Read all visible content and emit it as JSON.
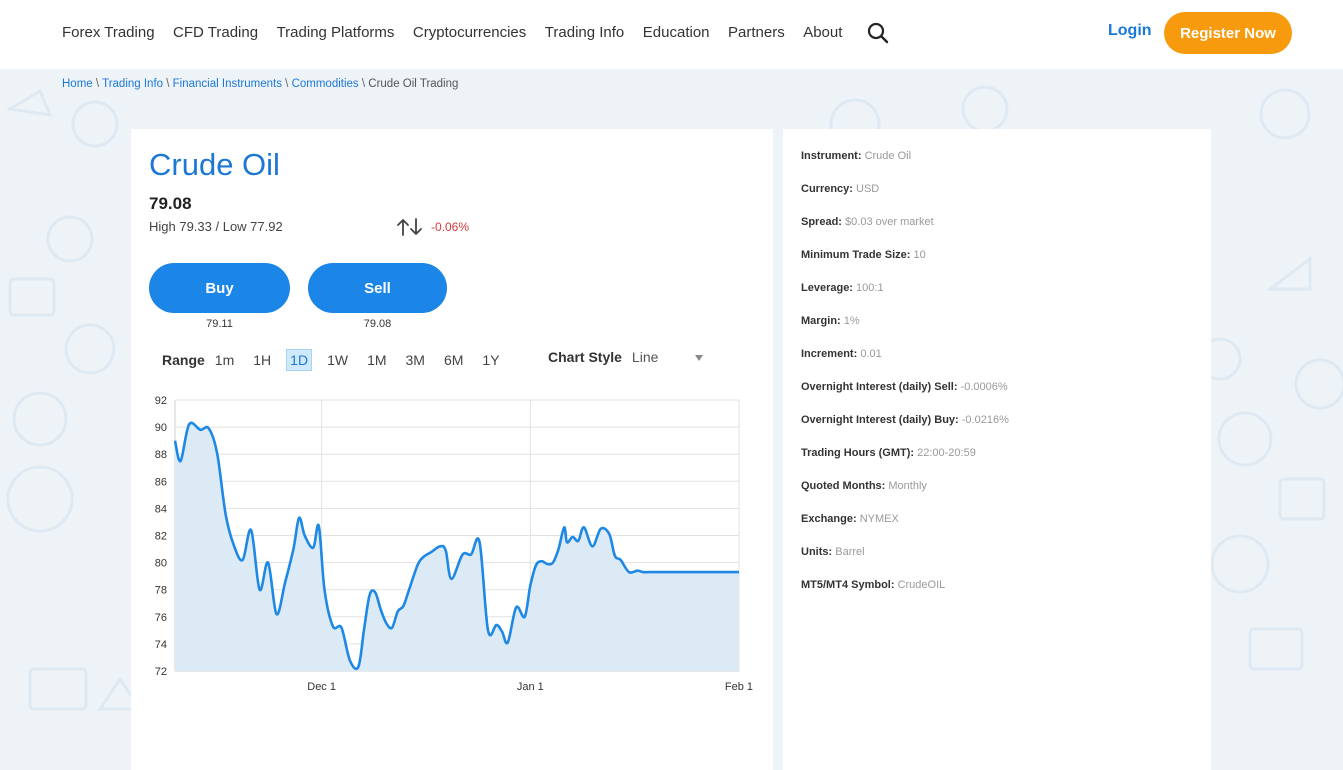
{
  "header": {
    "nav": [
      "Forex Trading",
      "CFD Trading",
      "Trading Platforms",
      "Cryptocurrencies",
      "Trading Info",
      "Education",
      "Partners",
      "About"
    ],
    "login_label": "Login",
    "register_label": "Register Now"
  },
  "breadcrumb": {
    "items": [
      "Home",
      "Trading Info",
      "Financial Instruments",
      "Commodities"
    ],
    "current": "Crude Oil Trading",
    "separator": "\\"
  },
  "instrument": {
    "title": "Crude Oil",
    "price": "79.08",
    "high_low": "High 79.33 / Low 77.92",
    "change": "-0.06%",
    "buy_label": "Buy",
    "buy_price": "79.11",
    "sell_label": "Sell",
    "sell_price": "79.08"
  },
  "controls": {
    "range_label": "Range",
    "ranges": [
      "1m",
      "1H",
      "1D",
      "1W",
      "1M",
      "3M",
      "6M",
      "1Y"
    ],
    "active_range": "1D",
    "chart_style_label": "Chart Style",
    "chart_style_value": "Line"
  },
  "details": [
    {
      "label": "Instrument:",
      "value": "Crude Oil"
    },
    {
      "label": "Currency:",
      "value": "USD"
    },
    {
      "label": "Spread:",
      "value": "$0.03 over market"
    },
    {
      "label": "Minimum Trade Size:",
      "value": "10"
    },
    {
      "label": "Leverage:",
      "value": "100:1"
    },
    {
      "label": "Margin:",
      "value": "1%"
    },
    {
      "label": "Increment:",
      "value": "0.01"
    },
    {
      "label": "Overnight Interest (daily) Sell:",
      "value": "-0.0006%"
    },
    {
      "label": "Overnight Interest (daily) Buy:",
      "value": "-0.0216%"
    },
    {
      "label": "Trading Hours (GMT):",
      "value": "22:00-20:59"
    },
    {
      "label": "Quoted Months:",
      "value": "Monthly"
    },
    {
      "label": "Exchange:",
      "value": "NYMEX"
    },
    {
      "label": "Units:",
      "value": "Barrel"
    },
    {
      "label": "MT5/MT4 Symbol:",
      "value": "CrudeOIL"
    }
  ],
  "colors": {
    "accent": "#1b78d6",
    "register": "#f79a0d",
    "negative": "#d23b3b",
    "line": "#1e88e5",
    "fill": "#dceaf5"
  },
  "chart_data": {
    "type": "area",
    "ylim": [
      72,
      92
    ],
    "yticks": [
      72,
      74,
      76,
      78,
      80,
      82,
      84,
      86,
      88,
      90,
      92
    ],
    "x_range": [
      0,
      100
    ],
    "xticks": [
      {
        "x": 26,
        "label": "Dec 1"
      },
      {
        "x": 63,
        "label": "Jan 1"
      },
      {
        "x": 100,
        "label": "Feb 1"
      }
    ],
    "x": [
      0,
      1,
      2.5,
      4.5,
      6,
      7.5,
      9,
      10.5,
      12,
      13.5,
      15,
      16.5,
      18,
      19.5,
      21,
      22,
      23,
      24.5,
      25.5,
      26.5,
      28,
      29.5,
      31,
      32.5,
      33.5,
      34.5,
      35.5,
      36.5,
      37.5,
      38.5,
      39.5,
      40.5,
      41.5,
      43,
      44,
      45.5,
      47,
      48,
      49,
      51,
      52.5,
      54,
      55.5,
      57,
      58,
      59,
      60.5,
      62,
      63,
      64,
      65,
      66,
      67,
      68,
      69,
      69.5,
      70.5,
      71.5,
      72.5,
      74,
      75.5,
      77,
      78,
      79,
      80.5,
      82,
      83,
      84,
      85,
      86.5,
      88,
      89.5,
      90.5,
      92,
      93.5,
      95,
      96.5,
      98,
      99,
      100
    ],
    "values": [
      89.0,
      87.5,
      90.2,
      89.8,
      89.9,
      88.0,
      83.5,
      81.2,
      80.2,
      82.4,
      78.0,
      80.0,
      76.2,
      78.5,
      81.0,
      83.3,
      82.0,
      81.1,
      82.7,
      78.0,
      75.3,
      75.2,
      72.8,
      72.3,
      75.0,
      77.6,
      77.8,
      76.5,
      75.5,
      75.2,
      76.4,
      76.8,
      78.0,
      79.8,
      80.4,
      80.8,
      81.2,
      80.9,
      78.8,
      80.6,
      80.6,
      81.5,
      75.0,
      75.4,
      74.9,
      74.1,
      76.7,
      76.0,
      78.3,
      79.8,
      80.1,
      79.9,
      80.0,
      81.0,
      82.6,
      81.5,
      81.9,
      81.6,
      82.6,
      81.2,
      82.5,
      82.1,
      80.5,
      80.2,
      79.3,
      79.4,
      79.3,
      79.3,
      79.3,
      79.3,
      79.3,
      79.3,
      79.3,
      79.3,
      79.3,
      79.3,
      79.3,
      79.3,
      79.3,
      79.3
    ]
  }
}
